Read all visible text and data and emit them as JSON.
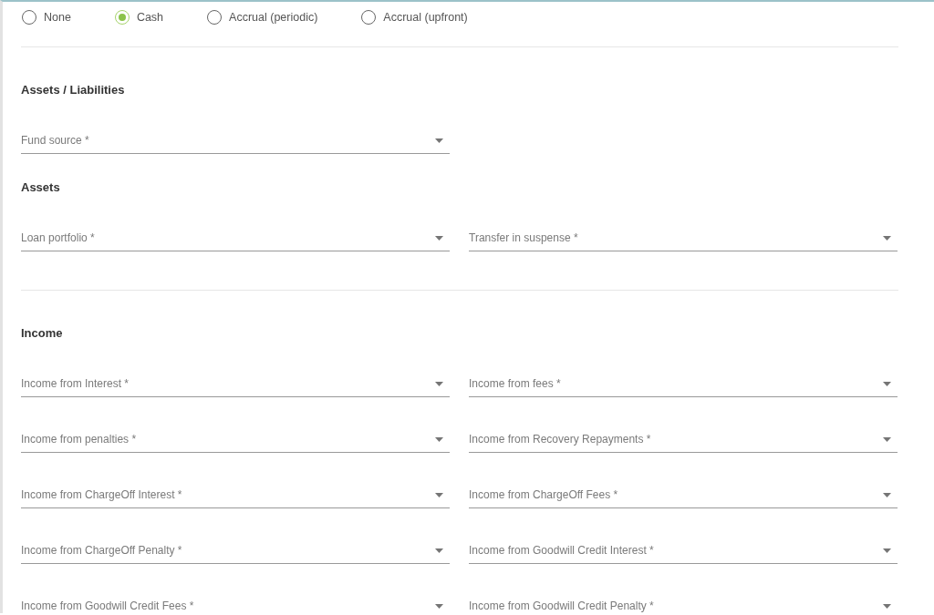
{
  "accounting_options": [
    {
      "label": "None",
      "selected": false
    },
    {
      "label": "Cash",
      "selected": true
    },
    {
      "label": "Accrual (periodic)",
      "selected": false
    },
    {
      "label": "Accrual (upfront)",
      "selected": false
    }
  ],
  "groups": [
    {
      "sections": [
        {
          "heading": "Assets / Liabilities",
          "fields": [
            {
              "placeholder": "Fund source *"
            }
          ]
        },
        {
          "heading": "Assets",
          "fields": [
            {
              "placeholder": "Loan portfolio *"
            },
            {
              "placeholder": "Transfer in suspense *"
            }
          ]
        }
      ]
    },
    {
      "sections": [
        {
          "heading": "Income",
          "fields": [
            {
              "placeholder": "Income from Interest *"
            },
            {
              "placeholder": "Income from fees *"
            },
            {
              "placeholder": "Income from penalties *"
            },
            {
              "placeholder": "Income from Recovery Repayments *"
            },
            {
              "placeholder": "Income from ChargeOff Interest *"
            },
            {
              "placeholder": "Income from ChargeOff Fees *"
            },
            {
              "placeholder": "Income from ChargeOff Penalty *"
            },
            {
              "placeholder": "Income from Goodwill Credit Interest *"
            },
            {
              "placeholder": "Income from Goodwill Credit Fees *"
            },
            {
              "placeholder": "Income from Goodwill Credit Penalty *"
            }
          ]
        }
      ]
    }
  ]
}
